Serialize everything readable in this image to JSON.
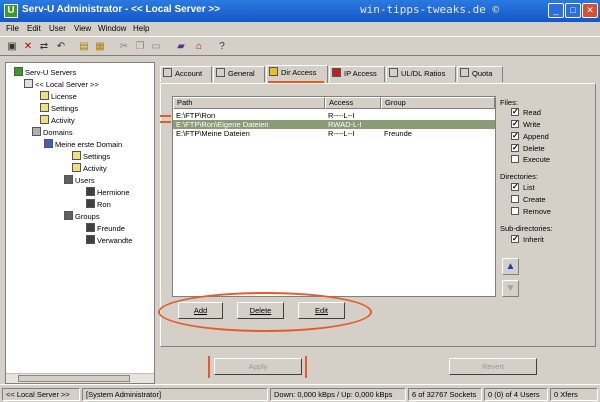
{
  "window": {
    "title": "Serv-U Administrator - << Local Server >>",
    "watermark": "win-tipps-tweaks.de ©",
    "app_icon": "U"
  },
  "menu": [
    "File",
    "Edit",
    "User",
    "View",
    "Window",
    "Help"
  ],
  "toolbar_icons": [
    "app-icon",
    "delete-icon",
    "move-icon",
    "undo-icon",
    "folder-icon",
    "save-icon",
    "cut-icon",
    "copy-icon",
    "paste-icon",
    "book-icon",
    "server-icon",
    "help-icon"
  ],
  "tree": {
    "root": "Serv-U Servers",
    "server": "<< Local Server >>",
    "license": "License",
    "settings": "Settings",
    "activity": "Activity",
    "domains": "Domains",
    "domain": "Meine erste Domain",
    "domain_settings": "Settings",
    "domain_activity": "Activity",
    "users": "Users",
    "user_1": "Hermione",
    "user_2": "Ron",
    "groups": "Groups",
    "group_1": "Freunde",
    "group_2": "Verwandte"
  },
  "tabs": [
    "Account",
    "General",
    "Dir Access",
    "IP Access",
    "UL/DL Ratios",
    "Quota"
  ],
  "table": {
    "headers": [
      "Path",
      "Access",
      "Group"
    ],
    "rows": [
      [
        "E:\\FTP\\Ron",
        "R----L--I",
        ""
      ],
      [
        "E:\\FTP\\Ron\\Eigene Dateien",
        "RWAD-L-I",
        ""
      ],
      [
        "E:\\FTP\\Meine Dateien",
        "R----L--I",
        "Freunde"
      ]
    ],
    "selected_row": 1
  },
  "files": {
    "label": "Files:",
    "read": "Read",
    "write": "Write",
    "append": "Append",
    "delete": "Delete",
    "execute": "Execute"
  },
  "directories": {
    "label": "Directories:",
    "list": "List",
    "create": "Create",
    "remove": "Remove"
  },
  "subdirectories": {
    "label": "Sub-directories:",
    "inherit": "Inherit"
  },
  "buttons": {
    "add": "Add",
    "delete": "Delete",
    "edit": "Edit",
    "apply": "Apply",
    "revert": "Revert"
  },
  "status": {
    "server": "<< Local Server >>",
    "user": "[System Administrator]",
    "speed": "Down: 0,000 kBps / Up: 0,000 kBps",
    "sockets": "6 of 32767 Sockets",
    "users": "0 (0) of 4 Users",
    "xfers": "0 Xfers"
  },
  "colors": {
    "titlebar": "#1456c7",
    "selection": "#8b9a77",
    "highlight": "#e55a2a"
  }
}
